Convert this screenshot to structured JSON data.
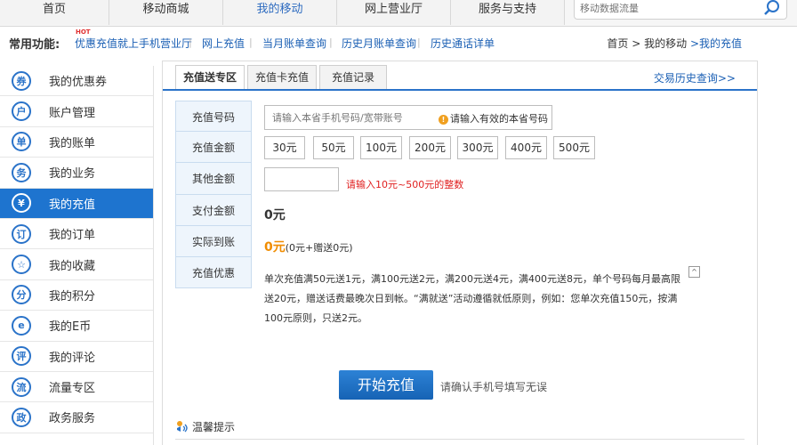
{
  "topnav": {
    "tabs": [
      "首页",
      "移动商城",
      "我的移动",
      "网上营业厅",
      "服务与支持"
    ],
    "search_placeholder": "移动数据流量"
  },
  "quickbar": {
    "label": "常用功能:",
    "hot": "HOT",
    "links": [
      "优惠充值就上手机营业厅",
      "网上充值",
      "当月账单查询",
      "历史月账单查询",
      "历史通话详单"
    ]
  },
  "breadcrumb": {
    "home": "首页",
    "sep": ">",
    "parent": "我的移动",
    "current": ">我的充值"
  },
  "sidebar": {
    "items": [
      {
        "label": "我的优惠券",
        "icon": "券"
      },
      {
        "label": "账户管理",
        "icon": "户"
      },
      {
        "label": "我的账单",
        "icon": "单"
      },
      {
        "label": "我的业务",
        "icon": "务"
      },
      {
        "label": "我的充值",
        "icon": "¥"
      },
      {
        "label": "我的订单",
        "icon": "订"
      },
      {
        "label": "我的收藏",
        "icon": "☆"
      },
      {
        "label": "我的积分",
        "icon": "分"
      },
      {
        "label": "我的E币",
        "icon": "e"
      },
      {
        "label": "我的评论",
        "icon": "评"
      },
      {
        "label": "流量专区",
        "icon": "流"
      },
      {
        "label": "政务服务",
        "icon": "政"
      }
    ],
    "active_index": 4
  },
  "main": {
    "tabs": [
      "充值送专区",
      "充值卡充值",
      "充值记录"
    ],
    "history_link": "交易历史查询>>",
    "row_labels": [
      "充值号码",
      "充值金额",
      "其他金额",
      "支付金额",
      "实际到账",
      "充值优惠"
    ],
    "phone": {
      "placeholder": "请输入本省手机号码/宽带账号",
      "warning": "请输入有效的本省号码",
      "warning_icon": "!"
    },
    "amounts": [
      "30元",
      "50元",
      "100元",
      "200元",
      "300元",
      "400元",
      "500元"
    ],
    "other_hint": "请输入10元~500元的整数",
    "pay_amount": "0元",
    "arrive_amount": "0元",
    "arrive_detail": "(0元+赠送0元)",
    "promo_text": "单次充值满50元送1元，满100元送2元，满200元送4元，满400元送8元，单个号码每月最高限送20元，赠送话费最晚次日到帐。“满就送”活动遵循就低原则，例如：您单次充值150元，按满100元原则，只送2元。",
    "collapse_symbol": "^",
    "start_button": "开始充值",
    "start_hint": "请确认手机号填写无误",
    "tips_label": "温馨提示"
  }
}
